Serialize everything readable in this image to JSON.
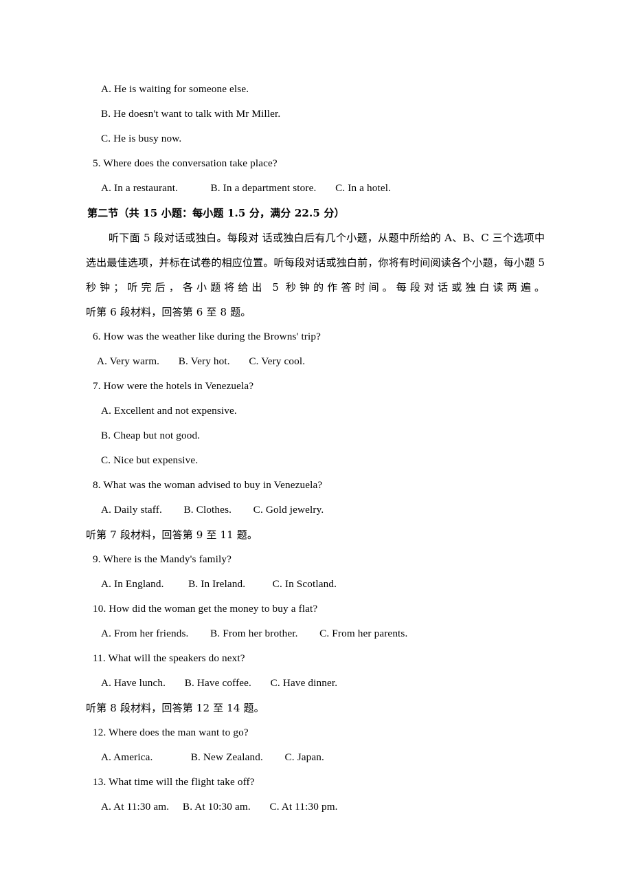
{
  "document": {
    "type": "english-exam-listening-section",
    "language": "zh-CN + en"
  },
  "q4_options": [
    "A. He is waiting for someone else.",
    "B. He doesn't want to talk with Mr Miller.",
    "C. He is busy now."
  ],
  "q5": {
    "stem": "5. Where does the conversation take place?",
    "options_line": "A. In a restaurant.            B. In a department store.       C. In a hotel."
  },
  "section": {
    "heading": "第二节（共 15 小题：每小题 1.5 分，满分 22.5 分）",
    "instructions_1": "听下面 5 段对话或独白。每段对 话或独白后有几个小题，从题中所给的 A、B、C 三个选项中选出最佳选项，并标在试卷的相应位置。听每段对话或独白前，你将有时间阅读各个小题，每小题 5 秒钟；听完后，各小题将给出 5 秒钟的作答时间。每段对话或独白读两遍。"
  },
  "directives": {
    "d6": "听第 6 段材料，回答第 6 至 8 题。",
    "d7": "听第 7 段材料，回答第 9 至 11 题。",
    "d8": "听第 8 段材料，回答第 12 至 14 题。"
  },
  "q6": {
    "stem": "6. How was the weather like during the Browns' trip?",
    "options_line": "A. Very warm.       B. Very hot.       C. Very cool."
  },
  "q7": {
    "stem": "7. How were the hotels in Venezuela?",
    "options": [
      "A. Excellent and not expensive.",
      "B. Cheap but not good.",
      "C. Nice but expensive."
    ]
  },
  "q8": {
    "stem": "8. What was the woman advised to buy in Venezuela?",
    "options_line": "A. Daily staff.        B. Clothes.        C. Gold jewelry."
  },
  "q9": {
    "stem": "9. Where is the Mandy's family?",
    "options_line": "A. In England.         B. In Ireland.          C. In Scotland."
  },
  "q10": {
    "stem": "10. How did the woman get the money to buy a flat?",
    "options_line": "A. From her friends.        B. From her brother.        C. From her parents."
  },
  "q11": {
    "stem": "11. What will the speakers do next?",
    "options_line": "A. Have lunch.       B. Have coffee.       C. Have dinner."
  },
  "q12": {
    "stem": "12. Where does the man want to go?",
    "options_line": "A. America.              B. New Zealand.        C. Japan."
  },
  "q13": {
    "stem": "13. What time will the flight take off?",
    "options_line": "A. At 11:30 am.     B. At 10:30 am.       C. At 11:30 pm."
  }
}
